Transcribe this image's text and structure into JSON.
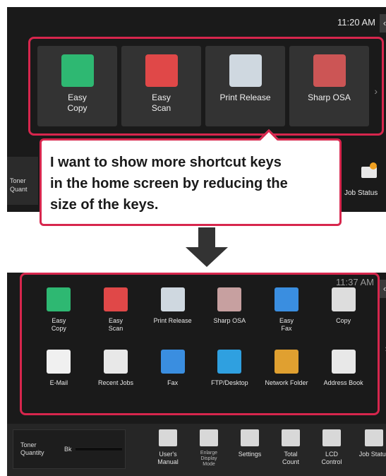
{
  "top": {
    "clock": "11:20 AM",
    "chevron": "‹",
    "keys": [
      {
        "label": "Easy\nCopy",
        "icon": "easy-copy-icon",
        "color": "#2eb872"
      },
      {
        "label": "Easy\nScan",
        "icon": "easy-scan-icon",
        "color": "#e04848"
      },
      {
        "label": "Print Release",
        "icon": "print-release-icon",
        "color": "#cfd8e0"
      },
      {
        "label": "Sharp OSA",
        "icon": "sharp-osa-icon",
        "color": "#cc5555"
      }
    ],
    "more": "›",
    "bottom_left": "Toner\nQuant",
    "job_status": "Job Status"
  },
  "callout": {
    "text": "I want to show more shortcut keys\nin the home screen by reducing the\nsize of the keys."
  },
  "bottom": {
    "clock": "11:37 AM",
    "chevron": "‹",
    "right_chevron": "›",
    "keys": [
      {
        "label": "Easy\nCopy",
        "icon": "easy-copy-icon",
        "color": "#2eb872"
      },
      {
        "label": "Easy\nScan",
        "icon": "easy-scan-icon",
        "color": "#e04848"
      },
      {
        "label": "Print Release",
        "icon": "print-release-icon",
        "color": "#cfd8e0"
      },
      {
        "label": "Sharp OSA",
        "icon": "sharp-osa-icon",
        "color": "#c7a0a0"
      },
      {
        "label": "Easy\nFax",
        "icon": "easy-fax-icon",
        "color": "#3a8ee0"
      },
      {
        "label": "Copy",
        "icon": "copy-icon",
        "color": "#dddddd"
      },
      {
        "label": "E-Mail",
        "icon": "email-icon",
        "color": "#f0f0f0"
      },
      {
        "label": "Recent Jobs",
        "icon": "recent-jobs-icon",
        "color": "#e8e8e8"
      },
      {
        "label": "Fax",
        "icon": "fax-icon",
        "color": "#3a8ee0"
      },
      {
        "label": "FTP/Desktop",
        "icon": "ftp-desktop-icon",
        "color": "#2fa0e0"
      },
      {
        "label": "Network Folder",
        "icon": "network-folder-icon",
        "color": "#e0a030"
      },
      {
        "label": "Address Book",
        "icon": "address-book-icon",
        "color": "#e8e8e8"
      }
    ],
    "status": {
      "toner_label": "Toner\nQuantity",
      "toner_bk": "Bk",
      "items": [
        {
          "label": "User's\nManual",
          "icon": "users-manual-icon"
        },
        {
          "label": "Enlarge\nDisplay\nMode",
          "icon": "enlarge-display-icon",
          "small": true
        },
        {
          "label": "Settings",
          "icon": "settings-icon"
        },
        {
          "label": "Total\nCount",
          "icon": "total-count-icon"
        },
        {
          "label": "LCD\nControl",
          "icon": "lcd-control-icon"
        },
        {
          "label": "Job Status",
          "icon": "job-status-icon"
        }
      ]
    }
  }
}
